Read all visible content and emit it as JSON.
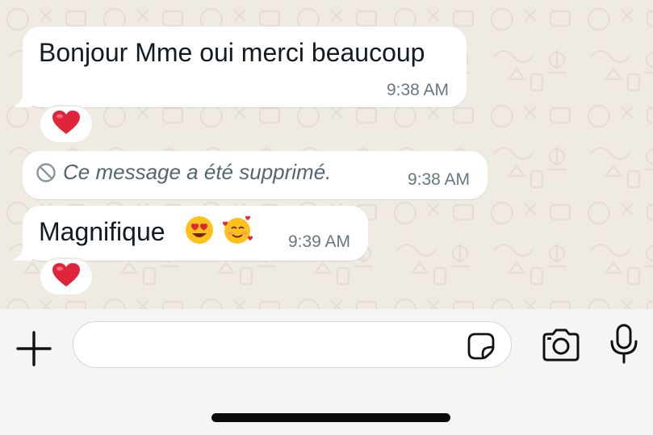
{
  "messages": [
    {
      "text": "Bonjour Mme oui merci beaucoup",
      "time": "9:38 AM",
      "reaction": "❤️"
    },
    {
      "text": "Ce message a été supprimé.",
      "time": "9:38 AM",
      "deleted": true,
      "icon": "block-icon"
    },
    {
      "text": "Magnifique",
      "emojis": [
        "😍",
        "🥰"
      ],
      "time": "9:39 AM",
      "reaction": "❤️"
    }
  ],
  "composer": {
    "input_value": "",
    "icons": [
      "plus-icon",
      "sticker-icon",
      "camera-icon",
      "mic-icon"
    ]
  },
  "colors": {
    "wallpaper": "#efeae2",
    "bubble": "#ffffff",
    "timestamp": "#667781",
    "heart": "#e0243b"
  }
}
